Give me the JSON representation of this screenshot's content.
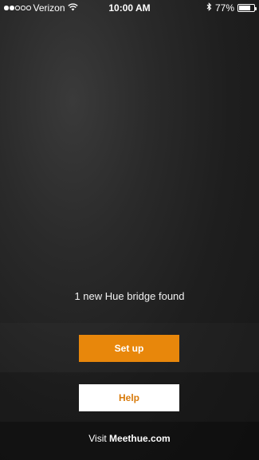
{
  "status_bar": {
    "carrier": "Verizon",
    "time": "10:00 AM",
    "battery": "77%",
    "battery_level": 0.77,
    "signal_bars_filled": 2,
    "signal_bars_total": 5,
    "icons": [
      "wifi-icon",
      "bluetooth-icon",
      "battery-icon"
    ]
  },
  "main": {
    "message": "1 new Hue bridge found",
    "setup_label": "Set up",
    "help_label": "Help"
  },
  "footer": {
    "prefix": "Visit",
    "link": "Meethue.com"
  },
  "colors": {
    "accent": "#e8870b",
    "help_text": "#d87a0a",
    "background": "#1e1e1e"
  }
}
